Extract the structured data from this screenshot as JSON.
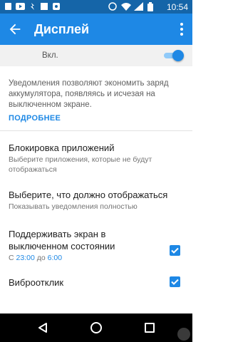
{
  "status": {
    "time": "10:54",
    "icons": [
      "sim-icon",
      "youtube-icon",
      "data-icon",
      "photo-icon",
      "notification-icon",
      "wifi-icon",
      "signal-icon",
      "battery-icon"
    ]
  },
  "appbar": {
    "title": "Дисплей"
  },
  "master": {
    "label": "Вкл.",
    "enabled": true
  },
  "description": "Уведомления позволяют экономить заряд аккумулятора, появляясь и исчезая на выключенном экране.",
  "more_link": "ПОДРОБНЕЕ",
  "settings": {
    "blocking": {
      "title": "Блокировка приложений",
      "summary": "Выберите приложения, которые не будут отображаться"
    },
    "choose": {
      "title": "Выберите, что должно отображаться",
      "summary": "Показывать уведомления полностью"
    },
    "keep_screen": {
      "title": "Поддерживать экран в выключенном состоянии",
      "summary_prefix": "С",
      "from": "23:00",
      "summary_mid": "до",
      "to": "6:00",
      "checked": true
    },
    "haptic": {
      "title": "Виброотклик",
      "checked": true
    }
  },
  "colors": {
    "accent": "#1e88e5",
    "statusbar": "#1565a8"
  }
}
